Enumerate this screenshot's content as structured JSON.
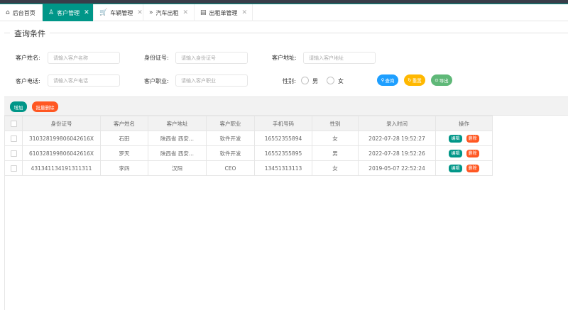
{
  "tabs": [
    {
      "icon": "⌂",
      "label": "后台首页"
    },
    {
      "icon": "♙",
      "label": "客户管理"
    },
    {
      "icon": "🛒",
      "label": "车辆管理"
    },
    {
      "icon": "»",
      "label": "汽车出租"
    },
    {
      "icon": "▤",
      "label": "出租单管理"
    }
  ],
  "form": {
    "legend": "查询条件",
    "name_label": "客户姓名:",
    "name_placeholder": "请输入客户名称",
    "idcard_label": "身份证号:",
    "idcard_placeholder": "请输入身份证号",
    "address_label": "客户地址:",
    "address_placeholder": "请输入客户地址",
    "phone_label": "客户电话:",
    "phone_placeholder": "请输入客户电话",
    "job_label": "客户职业:",
    "job_placeholder": "请输入客户职业",
    "gender_label": "性别:",
    "gender_male": "男",
    "gender_female": "女",
    "search_label": "查询",
    "reset_label": "重置",
    "export_label": "导出"
  },
  "toolbar": {
    "add_label": "增加",
    "batch_delete_label": "批量删除"
  },
  "table": {
    "columns": [
      "身份证号",
      "客户姓名",
      "客户地址",
      "客户职业",
      "手机号码",
      "性别",
      "录入时间",
      "操作"
    ],
    "rows": [
      {
        "idcard": "310328199806042616X",
        "name": "石田",
        "address": "陕西省 西安...",
        "job": "软件开发",
        "phone": "16552355894",
        "gender": "女",
        "time": "2022-07-28 19:52:27",
        "edit": "编辑",
        "delete": "删除"
      },
      {
        "idcard": "610328199806042616X",
        "name": "罗天",
        "address": "陕西省 西安...",
        "job": "软件开发",
        "phone": "16552355895",
        "gender": "男",
        "time": "2022-07-28 19:52:26",
        "edit": "编辑",
        "delete": "删除"
      },
      {
        "idcard": "431341134191311311",
        "name": "李四",
        "address": "汉阳",
        "job": "CEO",
        "phone": "13451313113",
        "gender": "女",
        "time": "2019-05-07 22:52:24",
        "edit": "编辑",
        "delete": "删除"
      }
    ]
  },
  "colors": {
    "accent": "#009688",
    "search": "#1e9fff",
    "reset": "#ffb800",
    "export": "#5fb878",
    "danger": "#ff5722",
    "topbar": "#393d49"
  }
}
